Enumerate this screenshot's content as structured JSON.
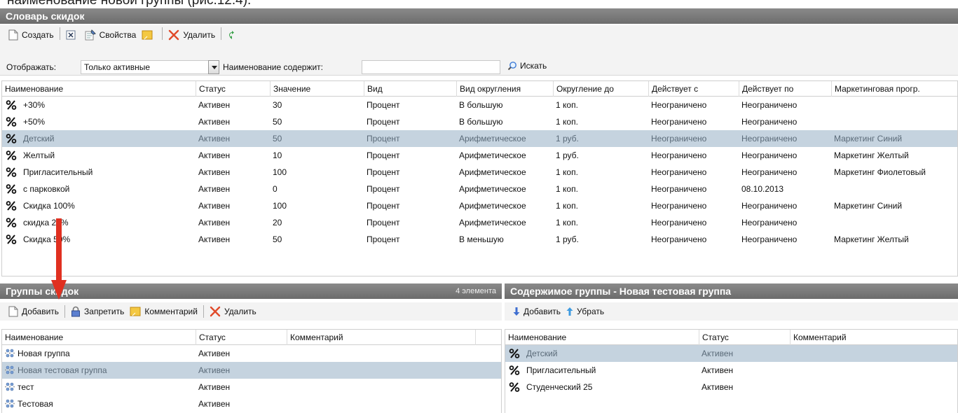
{
  "caption": "наименование новой группы (рис.12.4).",
  "dictionary": {
    "title": "Словарь скидок",
    "toolbar": {
      "create": "Создать",
      "properties": "Свойства",
      "delete": "Удалить"
    },
    "filter": {
      "show_label": "Отображать:",
      "show_value": "Только активные",
      "name_contains_label": "Наименование содержит:",
      "name_contains_value": "",
      "search": "Искать"
    },
    "columns": [
      "Наименование",
      "Статус",
      "Значение",
      "Вид",
      "Вид округления",
      "Округление до",
      "Действует с",
      "Действует по",
      "Маркетинговая прогр."
    ],
    "rows": [
      {
        "name": "+30%",
        "status": "Активен",
        "value": "30",
        "kind": "Процент",
        "rounding": "В большую",
        "round_to": "1 коп.",
        "from": "Неограничено",
        "to": "Неограничено",
        "marketing": ""
      },
      {
        "name": "+50%",
        "status": "Активен",
        "value": "50",
        "kind": "Процент",
        "rounding": "В большую",
        "round_to": "1 коп.",
        "from": "Неограничено",
        "to": "Неограничено",
        "marketing": ""
      },
      {
        "name": "Детский",
        "status": "Активен",
        "value": "50",
        "kind": "Процент",
        "rounding": "Арифметическое",
        "round_to": "1 руб.",
        "from": "Неограничено",
        "to": "Неограничено",
        "marketing": "Маркетинг Синий",
        "selected": true
      },
      {
        "name": "Желтый",
        "status": "Активен",
        "value": "10",
        "kind": "Процент",
        "rounding": "Арифметическое",
        "round_to": "1 руб.",
        "from": "Неограничено",
        "to": "Неограничено",
        "marketing": "Маркетинг Желтый"
      },
      {
        "name": "Пригласительный",
        "status": "Активен",
        "value": "100",
        "kind": "Процент",
        "rounding": "Арифметическое",
        "round_to": "1 коп.",
        "from": "Неограничено",
        "to": "Неограничено",
        "marketing": "Маркетинг Фиолетовый"
      },
      {
        "name": "с парковкой",
        "status": "Активен",
        "value": "0",
        "kind": "Процент",
        "rounding": "Арифметическое",
        "round_to": "1 коп.",
        "from": "Неограничено",
        "to": "08.10.2013",
        "marketing": ""
      },
      {
        "name": "Скидка 100%",
        "status": "Активен",
        "value": "100",
        "kind": "Процент",
        "rounding": "Арифметическое",
        "round_to": "1 коп.",
        "from": "Неограничено",
        "to": "Неограничено",
        "marketing": "Маркетинг Синий"
      },
      {
        "name": "скидка 20%",
        "status": "Активен",
        "value": "20",
        "kind": "Процент",
        "rounding": "Арифметическое",
        "round_to": "1 коп.",
        "from": "Неограничено",
        "to": "Неограничено",
        "marketing": ""
      },
      {
        "name": "Скидка 50%",
        "status": "Активен",
        "value": "50",
        "kind": "Процент",
        "rounding": "В меньшую",
        "round_to": "1 руб.",
        "from": "Неограничено",
        "to": "Неограничено",
        "marketing": "Маркетинг Желтый"
      }
    ]
  },
  "groups": {
    "title": "Группы скидок",
    "count": "4 элемента",
    "toolbar": {
      "add": "Добавить",
      "forbid": "Запретить",
      "comment": "Комментарий",
      "delete": "Удалить"
    },
    "columns": [
      "Наименование",
      "Статус",
      "Комментарий"
    ],
    "rows": [
      {
        "name": "Новая группа",
        "status": "Активен",
        "comment": ""
      },
      {
        "name": "Новая тестовая группа",
        "status": "Активен",
        "comment": "",
        "selected": true
      },
      {
        "name": "тест",
        "status": "Активен",
        "comment": ""
      },
      {
        "name": "Тестовая",
        "status": "Активен",
        "comment": ""
      }
    ]
  },
  "group_contents": {
    "title": "Содержимое группы - Новая тестовая группа",
    "toolbar": {
      "add": "Добавить",
      "remove": "Убрать"
    },
    "columns": [
      "Наименование",
      "Статус",
      "Комментарий"
    ],
    "rows": [
      {
        "name": "Детский",
        "status": "Активен",
        "comment": "",
        "selected": true
      },
      {
        "name": "Пригласительный",
        "status": "Активен",
        "comment": ""
      },
      {
        "name": "Студенческий 25",
        "status": "Активен",
        "comment": ""
      }
    ]
  },
  "colors": {
    "header_bg": "#7a7a7a",
    "selection_bg": "#c5d3df",
    "annotation_arrow": "#e03020"
  }
}
